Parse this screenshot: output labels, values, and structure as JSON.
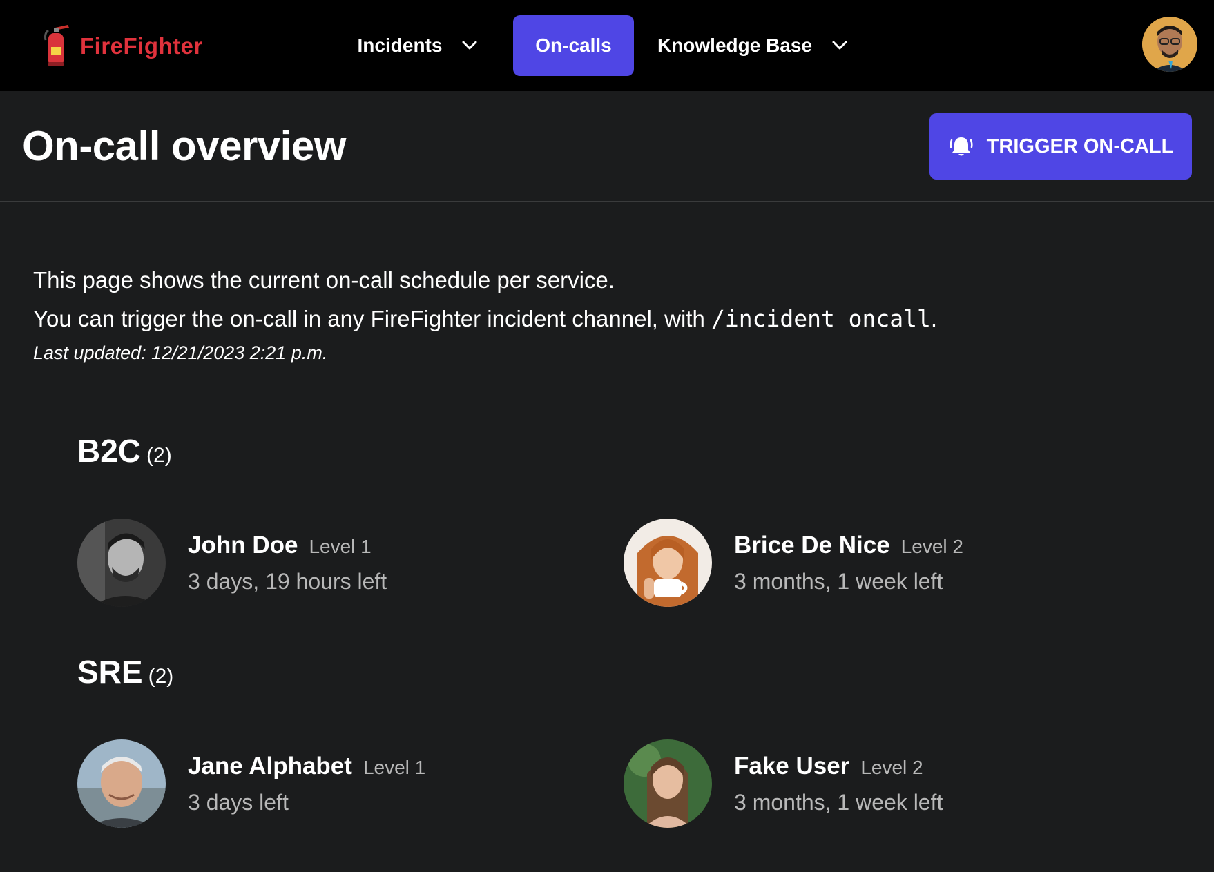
{
  "brand": {
    "name": "FireFighter",
    "color": "#e0323c"
  },
  "nav": {
    "items": [
      {
        "label": "Incidents",
        "has_dropdown": true,
        "active": false
      },
      {
        "label": "On-calls",
        "has_dropdown": false,
        "active": true
      },
      {
        "label": "Knowledge Base",
        "has_dropdown": true,
        "active": false
      }
    ],
    "accent": "#4f46e5"
  },
  "header": {
    "title": "On-call overview",
    "trigger_label": "TRIGGER ON-CALL",
    "trigger_icon": "bell-ringing-icon"
  },
  "description": {
    "line1": "This page shows the current on-call schedule per service.",
    "line2_prefix": "You can trigger the on-call in any FireFighter incident channel, with ",
    "line2_code": "/incident oncall",
    "line2_suffix": ".",
    "last_updated": "Last updated: 12/21/2023 2:21 p.m."
  },
  "services": [
    {
      "name": "B2C",
      "count": "(2)",
      "people": [
        {
          "name": "John Doe",
          "level": "Level 1",
          "time_left": "3 days, 19 hours left"
        },
        {
          "name": "Brice De Nice",
          "level": "Level 2",
          "time_left": "3 months, 1 week left"
        }
      ]
    },
    {
      "name": "SRE",
      "count": "(2)",
      "people": [
        {
          "name": "Jane Alphabet",
          "level": "Level 1",
          "time_left": "3 days left"
        },
        {
          "name": "Fake User",
          "level": "Level 2",
          "time_left": "3 months, 1 week left"
        }
      ]
    }
  ]
}
